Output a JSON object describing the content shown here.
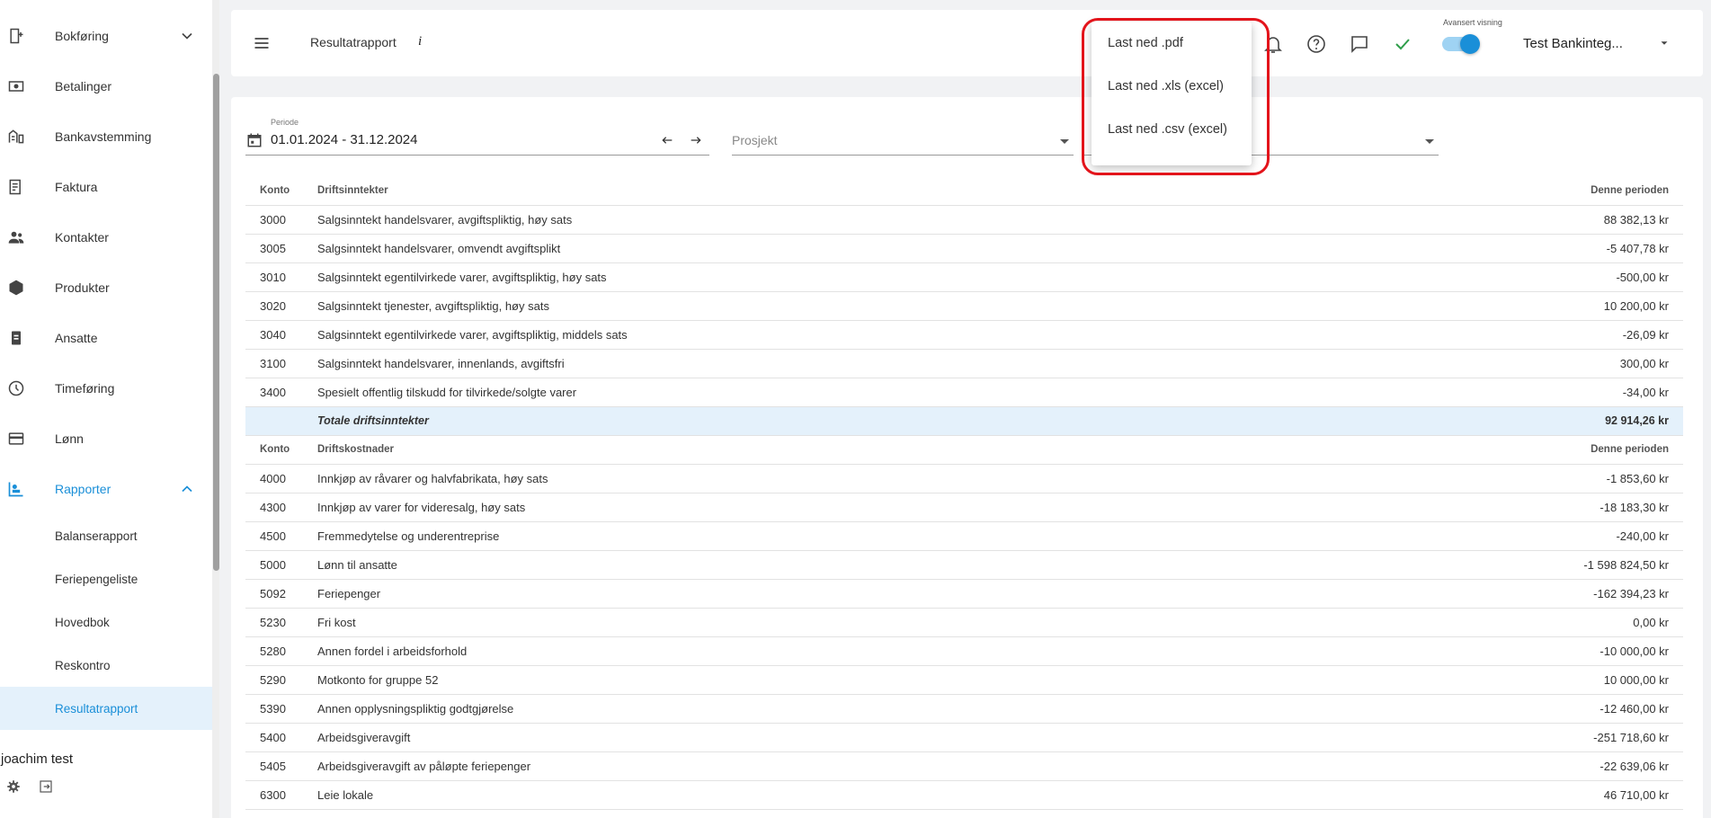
{
  "sidebar": {
    "items": [
      {
        "label": "Bokføring",
        "icon": "bookkeeping-icon"
      },
      {
        "label": "Betalinger",
        "icon": "payments-icon"
      },
      {
        "label": "Bankavstemming",
        "icon": "bank-reconciliation-icon"
      },
      {
        "label": "Faktura",
        "icon": "invoice-icon"
      },
      {
        "label": "Kontakter",
        "icon": "contacts-icon"
      },
      {
        "label": "Produkter",
        "icon": "products-icon"
      },
      {
        "label": "Ansatte",
        "icon": "employees-icon"
      },
      {
        "label": "Timeføring",
        "icon": "clock-icon"
      },
      {
        "label": "Lønn",
        "icon": "payroll-card-icon"
      },
      {
        "label": "Rapporter",
        "icon": "reports-icon"
      }
    ],
    "subitems": [
      "Balanserapport",
      "Feriepengeliste",
      "Hovedbok",
      "Reskontro",
      "Resultatrapport"
    ],
    "user": "joachim test"
  },
  "topbar": {
    "title": "Resultatrapport",
    "info": "i",
    "advanced_label": "Avansert visning",
    "company": "Test Bankinteg..."
  },
  "filters": {
    "period_label": "Periode",
    "period_value": "01.01.2024 - 31.12.2024",
    "project_placeholder": "Prosjekt"
  },
  "download_menu": {
    "items": [
      "Last ned .pdf",
      "Last ned .xls (excel)",
      "Last ned .csv (excel)"
    ]
  },
  "report": {
    "income": {
      "header": {
        "konto": "Konto",
        "name": "Driftsinntekter",
        "period": "Denne perioden"
      },
      "rows": [
        {
          "konto": "3000",
          "name": "Salgsinntekt handelsvarer, avgiftspliktig, høy sats",
          "value": "88 382,13 kr"
        },
        {
          "konto": "3005",
          "name": "Salgsinntekt handelsvarer, omvendt avgiftsplikt",
          "value": "-5 407,78 kr"
        },
        {
          "konto": "3010",
          "name": "Salgsinntekt egentilvirkede varer, avgiftspliktig, høy sats",
          "value": "-500,00 kr"
        },
        {
          "konto": "3020",
          "name": "Salgsinntekt tjenester, avgiftspliktig, høy sats",
          "value": "10 200,00 kr"
        },
        {
          "konto": "3040",
          "name": "Salgsinntekt egentilvirkede varer, avgiftspliktig, middels sats",
          "value": "-26,09 kr"
        },
        {
          "konto": "3100",
          "name": "Salgsinntekt handelsvarer, innenlands, avgiftsfri",
          "value": "300,00 kr"
        },
        {
          "konto": "3400",
          "name": "Spesielt offentlig tilskudd for tilvirkede/solgte varer",
          "value": "-34,00 kr"
        }
      ],
      "total": {
        "name": "Totale driftsinntekter",
        "value": "92 914,26 kr"
      }
    },
    "costs": {
      "header": {
        "konto": "Konto",
        "name": "Driftskostnader",
        "period": "Denne perioden"
      },
      "rows": [
        {
          "konto": "4000",
          "name": "Innkjøp av råvarer og halvfabrikata, høy sats",
          "value": "-1 853,60 kr"
        },
        {
          "konto": "4300",
          "name": "Innkjøp av varer for videresalg, høy sats",
          "value": "-18 183,30 kr"
        },
        {
          "konto": "4500",
          "name": "Fremmedytelse og underentreprise",
          "value": "-240,00 kr"
        },
        {
          "konto": "5000",
          "name": "Lønn til ansatte",
          "value": "-1 598 824,50 kr"
        },
        {
          "konto": "5092",
          "name": "Feriepenger",
          "value": "-162 394,23 kr"
        },
        {
          "konto": "5230",
          "name": "Fri kost",
          "value": "0,00 kr"
        },
        {
          "konto": "5280",
          "name": "Annen fordel i arbeidsforhold",
          "value": "-10 000,00 kr"
        },
        {
          "konto": "5290",
          "name": "Motkonto for gruppe 52",
          "value": "10 000,00 kr"
        },
        {
          "konto": "5390",
          "name": "Annen opplysningspliktig godtgjørelse",
          "value": "-12 460,00 kr"
        },
        {
          "konto": "5400",
          "name": "Arbeidsgiveravgift",
          "value": "-251 718,60 kr"
        },
        {
          "konto": "5405",
          "name": "Arbeidsgiveravgift av påløpte feriepenger",
          "value": "-22 639,06 kr"
        },
        {
          "konto": "6300",
          "name": "Leie lokale",
          "value": "46 710,00 kr"
        }
      ]
    }
  },
  "colors": {
    "accent": "#1a8fd8",
    "highlight": "#e3141b",
    "check": "#2e9e4a"
  }
}
